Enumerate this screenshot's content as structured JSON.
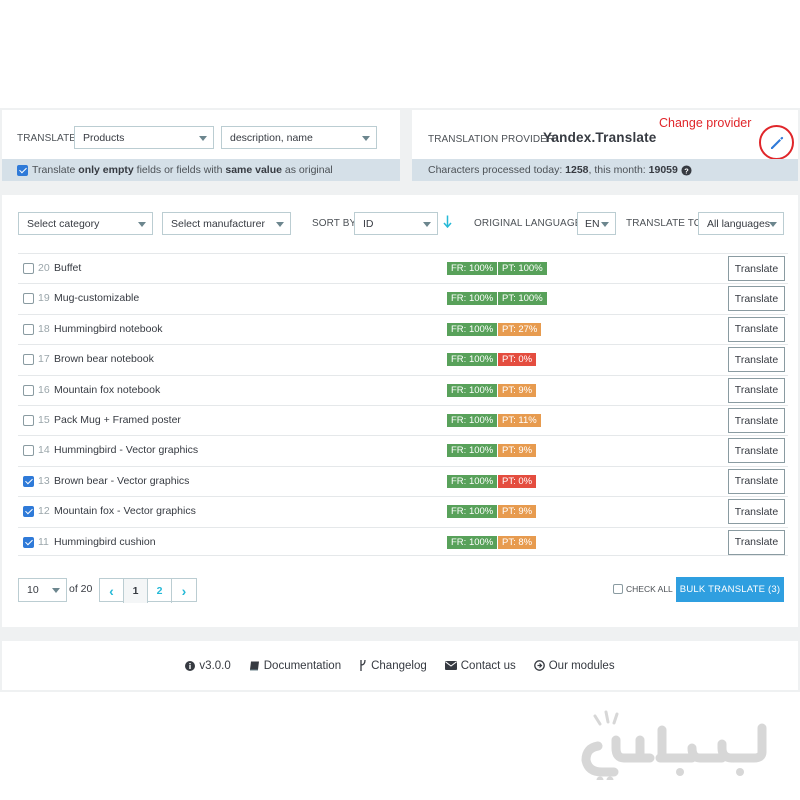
{
  "translate_panel": {
    "label": "TRANSLATE",
    "entity_select": "Products",
    "fields_select": "description, name",
    "only_empty": {
      "checked": true,
      "text_1": "Translate ",
      "text_2": "only empty",
      "text_3": " fields or fields with ",
      "text_4": "same value",
      "text_5": " as original"
    }
  },
  "provider_panel": {
    "label": "TRANSLATION PROVIDER",
    "provider": "Yandex.Translate",
    "change_label": "Change provider",
    "stats_prefix": "Characters processed today: ",
    "today": "1258",
    "stats_mid": ", this month: ",
    "month": "19059"
  },
  "filters": {
    "category": "Select category",
    "manufacturer": "Select manufacturer",
    "sort_label": "SORT BY",
    "sort_value": "ID",
    "orig_lang_label": "ORIGINAL LANGUAGE",
    "orig_lang_value": "EN",
    "translate_to_label": "TRANSLATE TO",
    "translate_to_value": "All languages"
  },
  "products": [
    {
      "id": "20",
      "name": "Buffet",
      "checked": false,
      "fr": "FR: 100%",
      "pt": "PT: 100%",
      "pt_status": "green",
      "action": "Translate"
    },
    {
      "id": "19",
      "name": "Mug-customizable",
      "checked": false,
      "fr": "FR: 100%",
      "pt": "PT: 100%",
      "pt_status": "green",
      "action": "Translate"
    },
    {
      "id": "18",
      "name": "Hummingbird notebook",
      "checked": false,
      "fr": "FR: 100%",
      "pt": "PT: 27%",
      "pt_status": "orange",
      "action": "Translate"
    },
    {
      "id": "17",
      "name": "Brown bear notebook",
      "checked": false,
      "fr": "FR: 100%",
      "pt": "PT: 0%",
      "pt_status": "red",
      "action": "Translate"
    },
    {
      "id": "16",
      "name": "Mountain fox notebook",
      "checked": false,
      "fr": "FR: 100%",
      "pt": "PT: 9%",
      "pt_status": "orange",
      "action": "Translate"
    },
    {
      "id": "15",
      "name": "Pack Mug + Framed poster",
      "checked": false,
      "fr": "FR: 100%",
      "pt": "PT: 11%",
      "pt_status": "orange",
      "action": "Translate"
    },
    {
      "id": "14",
      "name": "Hummingbird - Vector graphics",
      "checked": false,
      "fr": "FR: 100%",
      "pt": "PT: 9%",
      "pt_status": "orange",
      "action": "Translate"
    },
    {
      "id": "13",
      "name": "Brown bear - Vector graphics",
      "checked": true,
      "fr": "FR: 100%",
      "pt": "PT: 0%",
      "pt_status": "red",
      "action": "Translate"
    },
    {
      "id": "12",
      "name": "Mountain fox - Vector graphics",
      "checked": true,
      "fr": "FR: 100%",
      "pt": "PT: 9%",
      "pt_status": "orange",
      "action": "Translate"
    },
    {
      "id": "11",
      "name": "Hummingbird cushion",
      "checked": true,
      "fr": "FR: 100%",
      "pt": "PT: 8%",
      "pt_status": "orange",
      "action": "Translate"
    }
  ],
  "pagination": {
    "per_page": "10",
    "of_label": "of 20",
    "prev": "‹",
    "pages": [
      "1",
      "2"
    ],
    "next": "›",
    "current_page": "1"
  },
  "bulk": {
    "check_all": "CHECK ALL",
    "button": "BULK TRANSLATE (3)"
  },
  "footer": {
    "version": "v3.0.0",
    "documentation": "Documentation",
    "changelog": "Changelog",
    "contact": "Contact us",
    "modules": "Our modules"
  },
  "watermark": {
    "text": "باسلام"
  },
  "colors": {
    "green": "#58a15a",
    "orange": "#e79b4f",
    "red": "#e44d3f",
    "accent": "#2f9fe0",
    "annotation": "#e0262a"
  }
}
